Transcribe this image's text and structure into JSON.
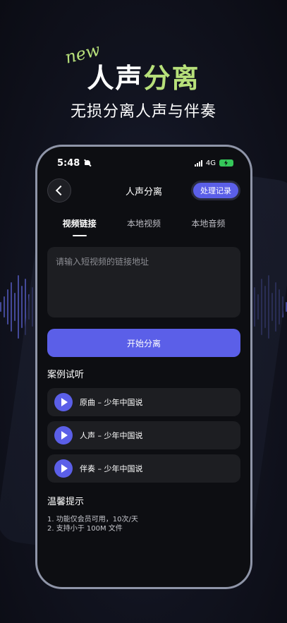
{
  "promo": {
    "new_tag": "new",
    "title_part1": "人声",
    "title_part2": "分离",
    "subtitle": "无损分离人声与伴奏"
  },
  "status_bar": {
    "time": "5:48",
    "network": "4G"
  },
  "nav": {
    "title": "人声分离",
    "history_button": "处理记录"
  },
  "tabs": [
    {
      "label": "视频链接",
      "active": true
    },
    {
      "label": "本地视频",
      "active": false
    },
    {
      "label": "本地音频",
      "active": false
    }
  ],
  "link_input": {
    "placeholder": "请输入短视频的链接地址",
    "value": ""
  },
  "start_button": "开始分离",
  "samples": {
    "title": "案例试听",
    "items": [
      {
        "label": "原曲 – 少年中国说"
      },
      {
        "label": "人声 – 少年中国说"
      },
      {
        "label": "伴奏 – 少年中国说"
      }
    ]
  },
  "tips": {
    "title": "温馨提示",
    "lines": [
      "1. 功能仅会员可用，10次/天",
      "2. 支持小于 100M 文件"
    ]
  },
  "colors": {
    "accent": "#5b5fe8",
    "highlight": "#b7e07a",
    "card": "#1d1e22"
  },
  "icons": [
    "back-arrow-icon",
    "mute-bell-icon",
    "signal-icon",
    "battery-icon",
    "play-icon"
  ]
}
